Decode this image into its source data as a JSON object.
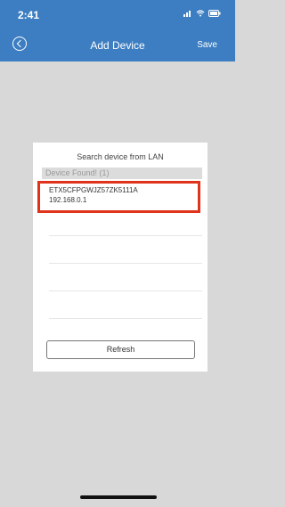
{
  "status": {
    "time": "2:41"
  },
  "nav": {
    "title": "Add Device",
    "save": "Save"
  },
  "dialog": {
    "title": "Search device from LAN",
    "found_header": "Device Found! (1)",
    "devices": [
      {
        "id": "ETX5CFPGWJZ57ZK5111A",
        "ip": "192.168.0.1"
      }
    ],
    "refresh_label": "Refresh"
  }
}
